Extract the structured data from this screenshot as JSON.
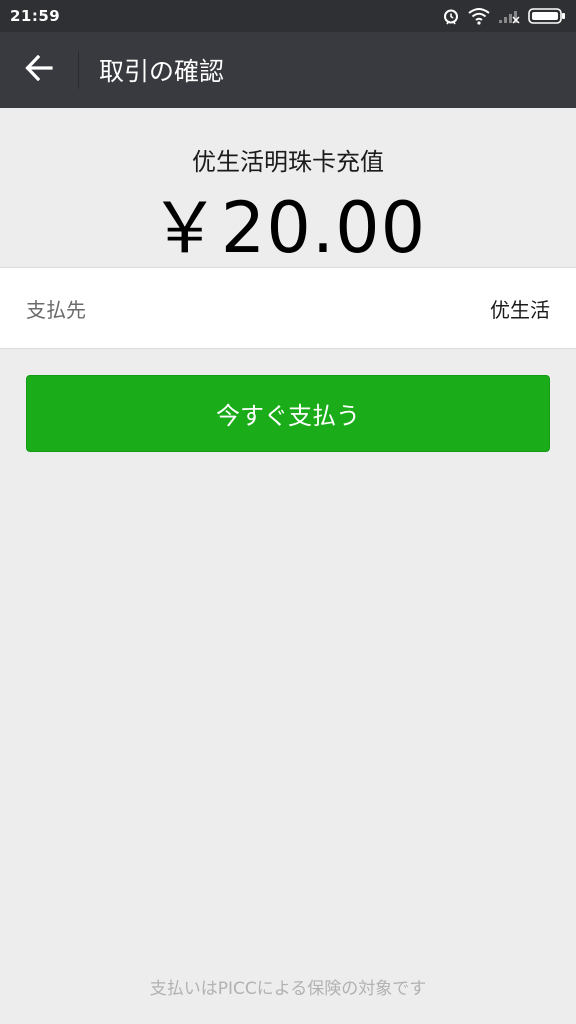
{
  "status_bar": {
    "time": "21:59",
    "icons": [
      "alarm-icon",
      "wifi-icon",
      "signal-icon",
      "battery-icon"
    ]
  },
  "app_bar": {
    "back_icon": "arrow-left-icon",
    "title": "取引の確認"
  },
  "payment": {
    "merchant_name": "优生活明珠卡充值",
    "amount": "￥20.00"
  },
  "payee": {
    "label": "支払先",
    "value": "优生活"
  },
  "pay_button": {
    "label": "今すぐ支払う"
  },
  "footer": {
    "note": "支払いはPICCによる保険の対象です"
  },
  "colors": {
    "status_bar_bg": "#2f3033",
    "app_bar_bg": "#393a3f",
    "page_bg": "#ededed",
    "primary_green": "#1aad19",
    "footer_text": "#b2b2b2"
  }
}
